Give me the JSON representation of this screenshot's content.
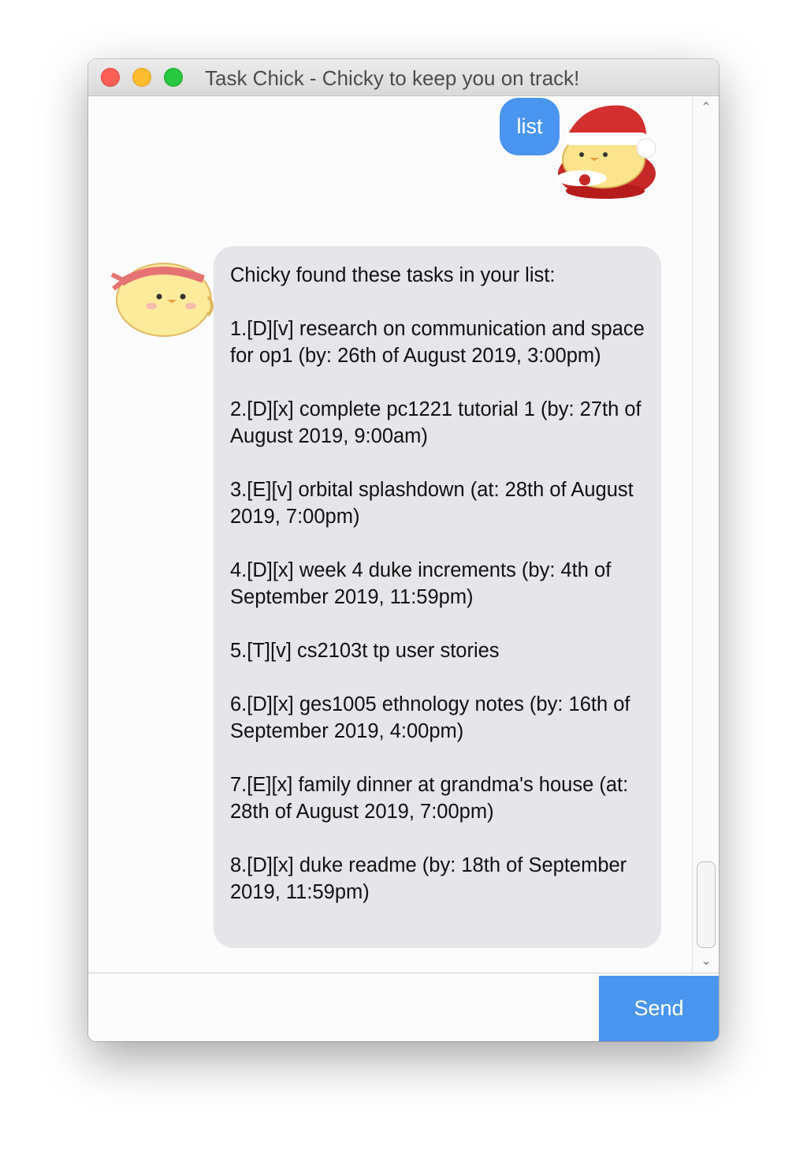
{
  "window": {
    "title": "Task Chick - Chicky to keep you on track!"
  },
  "chat": {
    "user_message": "list",
    "bot_intro": "Chicky found these tasks in your list:",
    "tasks": [
      "1.[D][v] research on communication and space for op1 (by: 26th of August 2019, 3:00pm)",
      "2.[D][x] complete pc1221 tutorial 1 (by: 27th of August 2019, 9:00am)",
      "3.[E][v] orbital splashdown (at: 28th of August 2019, 7:00pm)",
      "4.[D][x] week 4 duke increments (by: 4th of September 2019, 11:59pm)",
      "5.[T][v] cs2103t tp user stories",
      "6.[D][x] ges1005 ethnology notes (by: 16th of September 2019, 4:00pm)",
      "7.[E][x] family dinner at grandma's house (at: 28th of August 2019, 7:00pm)",
      "8.[D][x] duke readme (by: 18th of September 2019, 11:59pm)"
    ]
  },
  "input": {
    "value": "",
    "placeholder": ""
  },
  "send_label": "Send",
  "icons": {
    "user_avatar": "santa-chick-avatar-icon",
    "bot_avatar": "headband-chick-avatar-icon",
    "scroll_up": "chevron-up-icon",
    "scroll_down": "chevron-down-icon"
  },
  "colors": {
    "accent": "#4a95ef",
    "bot_bubble": "#e5e5ea",
    "close": "#fe5f57",
    "minimize": "#febc2e",
    "maximize": "#28c840"
  }
}
